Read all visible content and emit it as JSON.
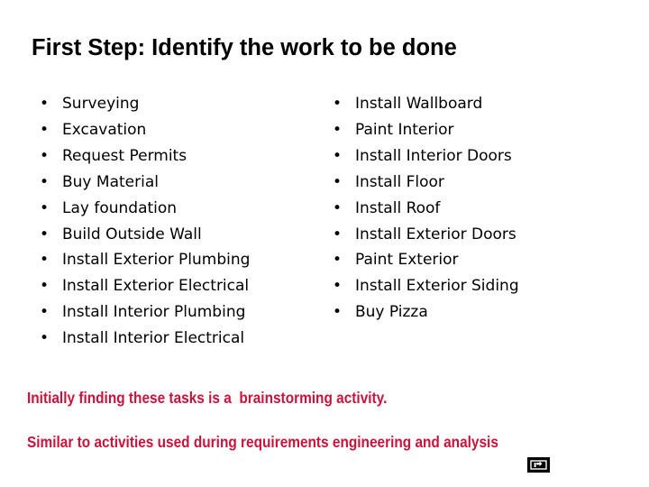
{
  "slide": {
    "title": "First Step: Identify the work to be done",
    "bullet_mark": "•",
    "columns": [
      {
        "name": "left",
        "items": [
          "Surveying",
          "Excavation",
          "Request Permits",
          "Buy Material",
          "Lay foundation",
          "Build Outside Wall",
          "Install Exterior Plumbing",
          "Install Exterior Electrical",
          "Install Interior Plumbing",
          "Install Interior Electrical"
        ]
      },
      {
        "name": "right",
        "items": [
          "Install Wallboard",
          "Paint Interior",
          "Install Interior Doors",
          "Install Floor",
          "Install Roof",
          "Install Exterior Doors",
          "Paint Exterior",
          "Install Exterior Siding",
          "Buy Pizza"
        ]
      }
    ],
    "notes": {
      "brainstorming": "Initially finding these tasks is a  brainstorming activity.",
      "requirements": "Similar to activities used during requirements engineering and analysis"
    },
    "colors": {
      "note_text": "#C8143C",
      "body_text": "#000000",
      "background": "#FFFFFF"
    }
  }
}
